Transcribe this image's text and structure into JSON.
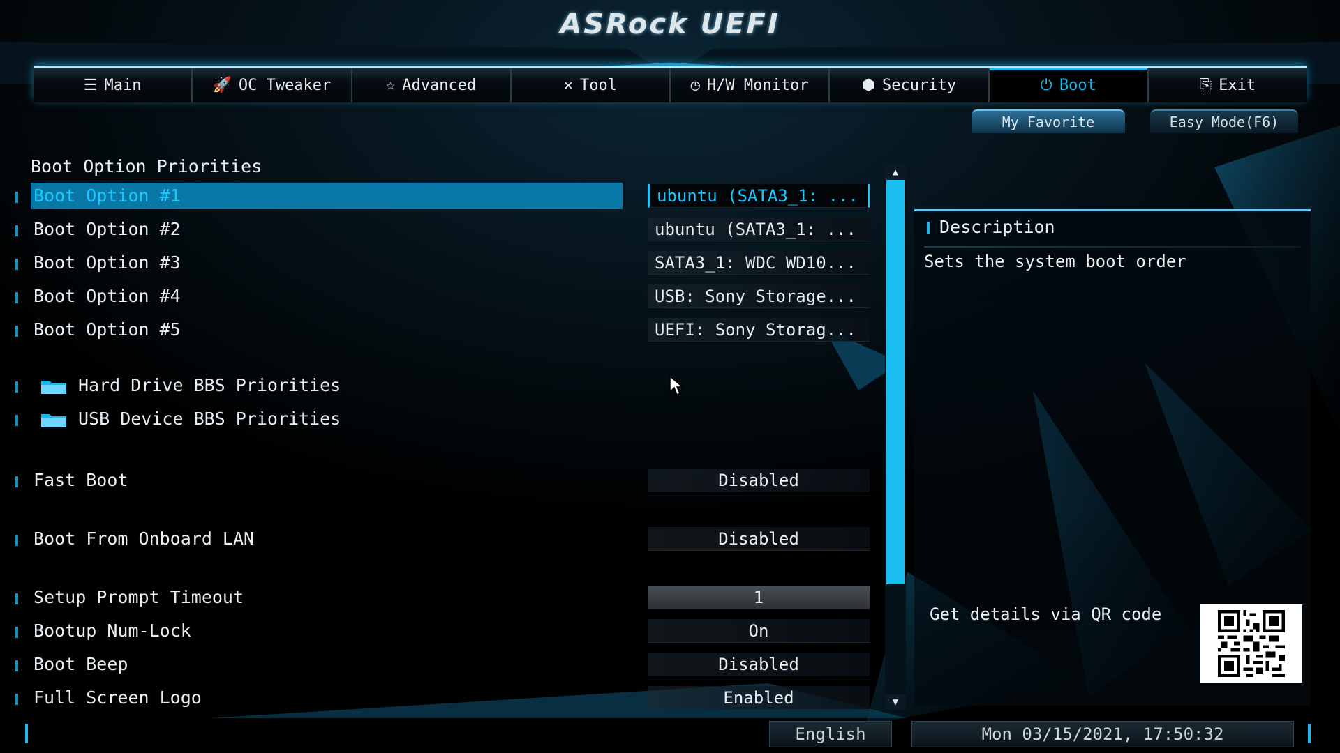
{
  "header": {
    "logo": "ASRock UEFI"
  },
  "tabs": [
    {
      "label": "Main",
      "icon": "list-icon",
      "glyph": "☰"
    },
    {
      "label": "OC Tweaker",
      "icon": "rocket-icon",
      "glyph": "🚀"
    },
    {
      "label": "Advanced",
      "icon": "star-icon",
      "glyph": "☆"
    },
    {
      "label": "Tool",
      "icon": "tools-icon",
      "glyph": "✕"
    },
    {
      "label": "H/W Monitor",
      "icon": "monitor-icon",
      "glyph": "◷"
    },
    {
      "label": "Security",
      "icon": "shield-icon",
      "glyph": "⬢"
    },
    {
      "label": "Boot",
      "icon": "power-icon",
      "glyph": "⏻"
    },
    {
      "label": "Exit",
      "icon": "exit-icon",
      "glyph": "⎘"
    }
  ],
  "active_tab": "Boot",
  "toolbar": {
    "favorite": "My Favorite",
    "easy_mode": "Easy Mode(F6)"
  },
  "section_title": "Boot Option Priorities",
  "settings": [
    {
      "label": "Boot Option #1",
      "value": "ubuntu (SATA3_1: ..."
    },
    {
      "label": "Boot Option #2",
      "value": "ubuntu (SATA3_1: ..."
    },
    {
      "label": "Boot Option #3",
      "value": "SATA3_1: WDC WD10..."
    },
    {
      "label": "Boot Option #4",
      "value": "USB: Sony Storage..."
    },
    {
      "label": "Boot Option #5",
      "value": "UEFI: Sony Storag..."
    },
    {
      "label": "Hard Drive BBS Priorities"
    },
    {
      "label": "USB Device BBS Priorities"
    },
    {
      "label": "Fast Boot",
      "value": "Disabled"
    },
    {
      "label": "Boot From Onboard LAN",
      "value": "Disabled"
    },
    {
      "label": "Setup Prompt Timeout",
      "value": "1"
    },
    {
      "label": "Bootup Num-Lock",
      "value": "On"
    },
    {
      "label": "Boot Beep",
      "value": "Disabled"
    },
    {
      "label": "Full Screen Logo",
      "value": "Enabled"
    }
  ],
  "description": {
    "heading": "Description",
    "text": "Sets the system boot order",
    "qr_label": "Get details via QR code"
  },
  "footer": {
    "language": "English",
    "datetime": "Mon 03/15/2021, 17:50:32"
  },
  "colors": {
    "accent": "#1eb6ea",
    "selection": "#0a78a6",
    "background": "#000000"
  }
}
